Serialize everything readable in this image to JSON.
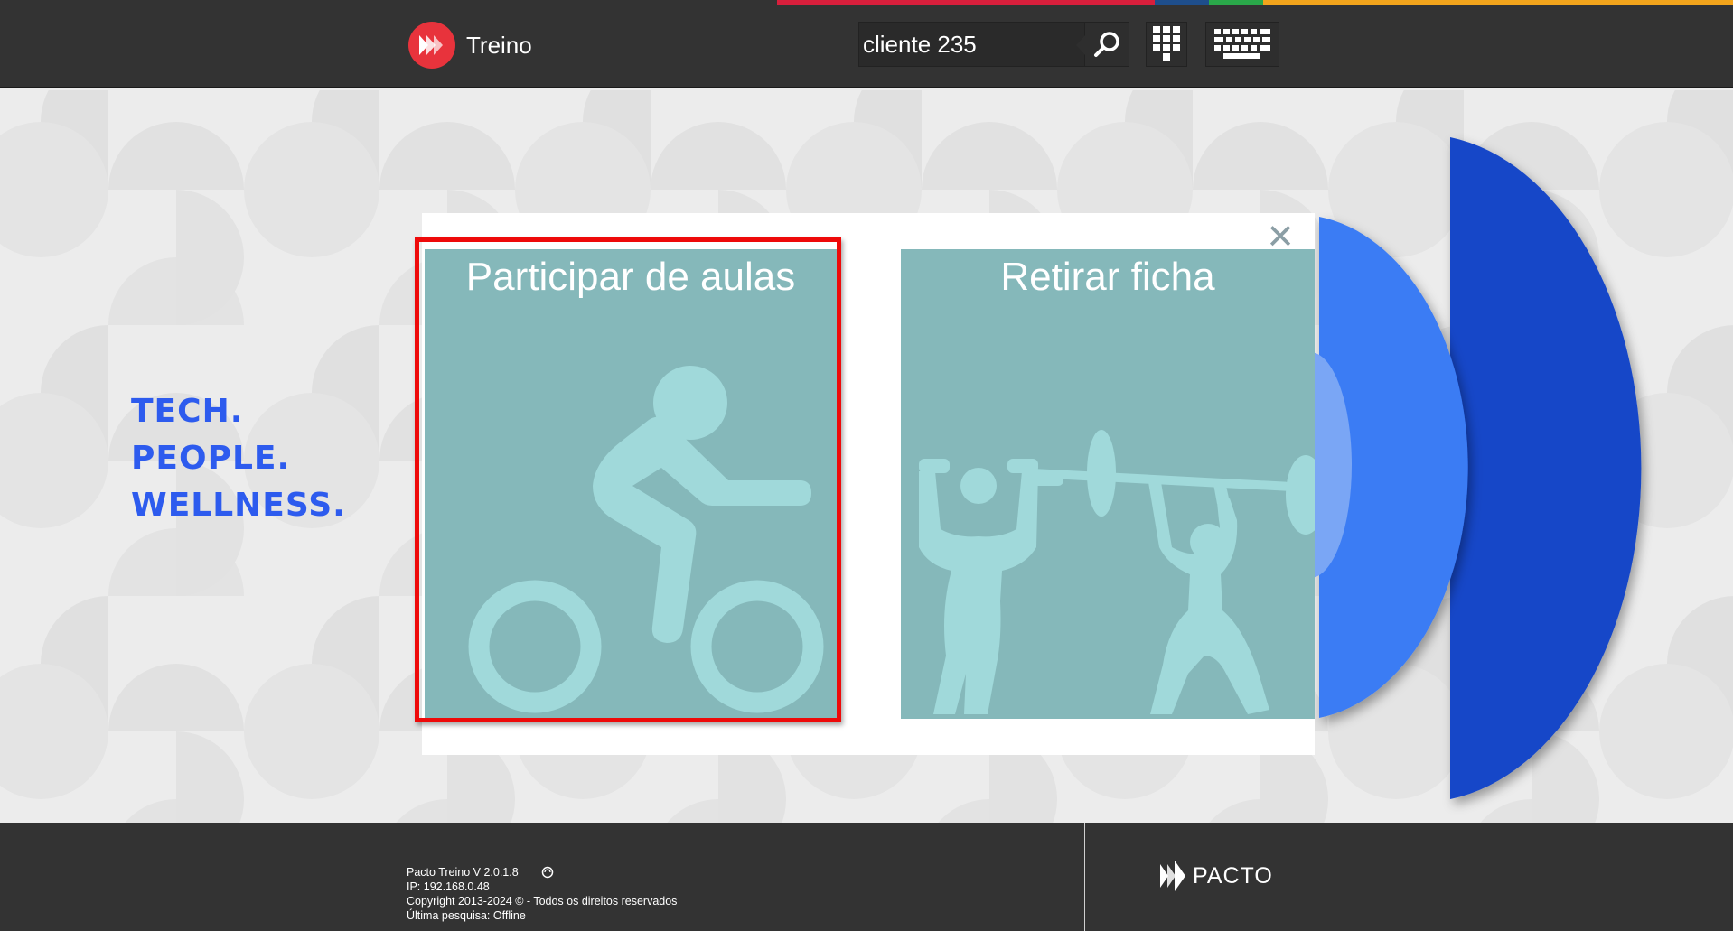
{
  "colors": {
    "header_bg": "#333333",
    "accent_red": "#e8333c",
    "tagline_blue": "#2d5bee",
    "card_bg": "#85b8ba",
    "card_icon": "#a0d9da",
    "highlight_red": "#ee0a0a"
  },
  "header": {
    "app_name": "Treino",
    "search": {
      "value": "cliente 235",
      "icon": "search-icon"
    },
    "keypad_icon": "keypad-icon",
    "keyboard_icon": "keyboard-icon"
  },
  "tagline": [
    "TECH.",
    "PEOPLE.",
    "WELLNESS."
  ],
  "modal": {
    "close_label": "✕",
    "cards": [
      {
        "title": "Participar de aulas",
        "icon": "cycling-icon"
      },
      {
        "title": "Retirar ficha",
        "icon": "weightlifting-icon"
      }
    ]
  },
  "footer": {
    "version": "Pacto Treino V 2.0.1.8",
    "ip": "IP: 192.168.0.48",
    "copyright": "Copyright 2013-2024 © - Todos os direitos reservados",
    "last_search": "Última pesquisa: Offline",
    "brand": "PACTO"
  }
}
